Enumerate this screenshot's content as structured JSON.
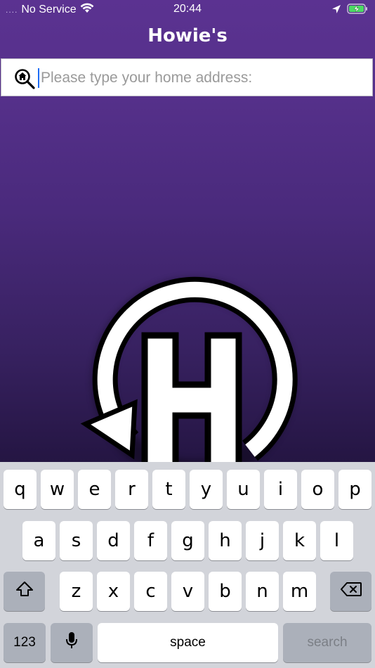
{
  "status_bar": {
    "signal_dots": "....",
    "carrier": "No Service",
    "time": "20:44",
    "icons": [
      "wifi-icon",
      "location-arrow-icon",
      "battery-charging-icon"
    ]
  },
  "nav": {
    "title": "Howie's"
  },
  "search": {
    "placeholder": "Please type your home address:",
    "value": "",
    "icon": "home-search-icon"
  },
  "logo": {
    "name": "howies-h-logo"
  },
  "keyboard": {
    "row1": [
      "q",
      "w",
      "e",
      "r",
      "t",
      "y",
      "u",
      "i",
      "o",
      "p"
    ],
    "row2": [
      "a",
      "s",
      "d",
      "f",
      "g",
      "h",
      "j",
      "k",
      "l"
    ],
    "row3": [
      "z",
      "x",
      "c",
      "v",
      "b",
      "n",
      "m"
    ],
    "numbers_label": "123",
    "space_label": "space",
    "search_label": "search",
    "icons": [
      "shift-icon",
      "backspace-icon",
      "microphone-icon"
    ]
  },
  "colors": {
    "header": "#5b3291",
    "background_bottom": "#1c1036",
    "keyboard": "#d2d4da",
    "accent_caret": "#1d6cf5"
  }
}
